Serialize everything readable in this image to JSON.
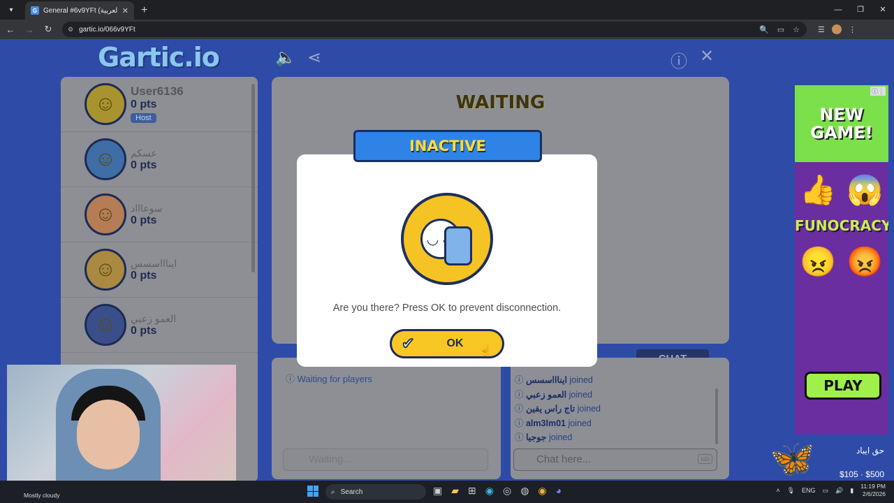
{
  "browser": {
    "tab_title": "General #6v9YFt (العربية) - Gartic",
    "url": "gartic.io/066v9YFt"
  },
  "game": {
    "logo": "Gartic.io",
    "status": "WAITING",
    "partial_text": "rt",
    "players": [
      {
        "name": "User6136",
        "pts": "0 pts",
        "badge": "Host"
      },
      {
        "name": "عسكم",
        "pts": "0 pts"
      },
      {
        "name": "سوعاااد",
        "pts": "0 pts"
      },
      {
        "name": "ايناااسسس",
        "pts": "0 pts"
      },
      {
        "name": "العمو زعبي",
        "pts": "0 pts"
      }
    ],
    "answers_status": "Waiting for players",
    "answer_placeholder": "Waiting...",
    "chat_tab": "CHAT",
    "chat_messages": [
      {
        "user": "ايناااسسس",
        "action": "joined"
      },
      {
        "user": "العمو زعبي",
        "action": "joined"
      },
      {
        "user": "تاج راس يقين",
        "action": "joined"
      },
      {
        "user": "alm3lm01",
        "action": "joined"
      },
      {
        "user": "جوجيا",
        "action": "joined"
      }
    ],
    "chat_placeholder": "Chat here...",
    "chat_key_hint": "tab"
  },
  "modal": {
    "title": "INACTIVE",
    "message": "Are you there? Press OK to prevent disconnection.",
    "ok_label": "OK"
  },
  "ad": {
    "headline": "NEW GAME!",
    "brand": "FUNOCRACY",
    "cta": "PLAY"
  },
  "overlay": {
    "donation_title": "حق ايباد",
    "donation_amount": "$105 · $500"
  },
  "taskbar": {
    "weather": "Mostly cloudy",
    "search": "Search",
    "lang": "ENG",
    "time": "11:19 PM",
    "date": "2/6/2026"
  }
}
